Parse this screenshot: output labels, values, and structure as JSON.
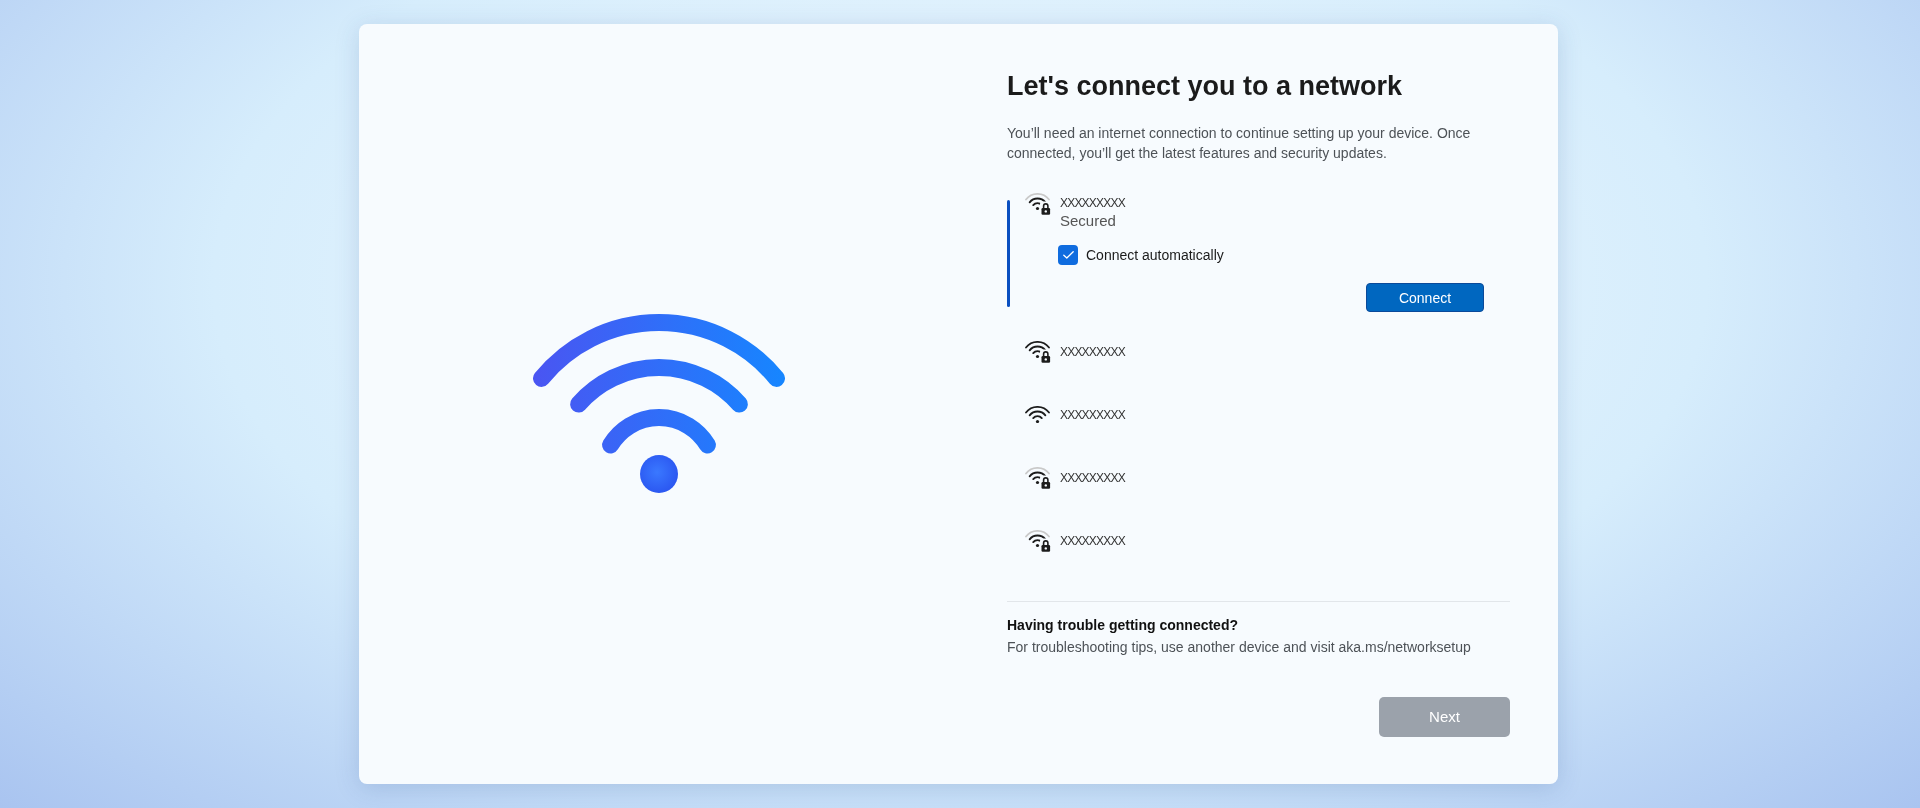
{
  "title": "Let's connect you to a network",
  "description": "You’ll need an internet connection to continue setting up your device. Once connected, you’ll get the latest features and security updates.",
  "networks": [
    {
      "name": "XXXXXXXXX",
      "selected": true,
      "secured": true,
      "kind": "good",
      "status": "Secured",
      "auto_connect": {
        "label": "Connect automatically",
        "checked": true
      },
      "button": "Connect"
    },
    {
      "name": "XXXXXXXXX",
      "selected": false,
      "secured": true,
      "kind": "full"
    },
    {
      "name": "XXXXXXXXX",
      "selected": false,
      "secured": false,
      "kind": "full"
    },
    {
      "name": "XXXXXXXXX",
      "selected": false,
      "secured": true,
      "kind": "good"
    },
    {
      "name": "XXXXXXXXX",
      "selected": false,
      "secured": true,
      "kind": "good"
    }
  ],
  "help": {
    "title": "Having trouble getting connected?",
    "text": "For troubleshooting tips, use another device and visit aka.ms/networksetup"
  },
  "next_button": {
    "label": "Next",
    "disabled": true
  }
}
